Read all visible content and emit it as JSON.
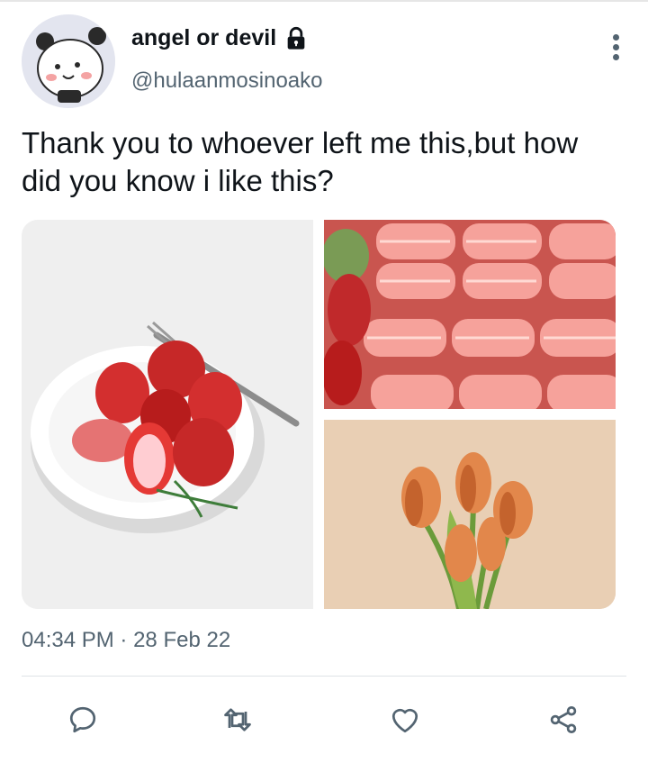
{
  "tweet": {
    "display_name": "angel or devil",
    "handle": "@hulaanmosinoako",
    "text": "Thank you to whoever left me this,but how did you know i like this?",
    "time": "04:34 PM",
    "separator": "·",
    "date": "28 Feb 22"
  },
  "icons": {
    "lock": "lock-icon",
    "more": "more-vertical-icon",
    "reply": "reply-icon",
    "retweet": "retweet-icon",
    "like": "heart-icon",
    "share": "share-icon"
  },
  "colors": {
    "text_primary": "#0f1419",
    "text_secondary": "#536471",
    "divider": "#dfe3e6"
  }
}
